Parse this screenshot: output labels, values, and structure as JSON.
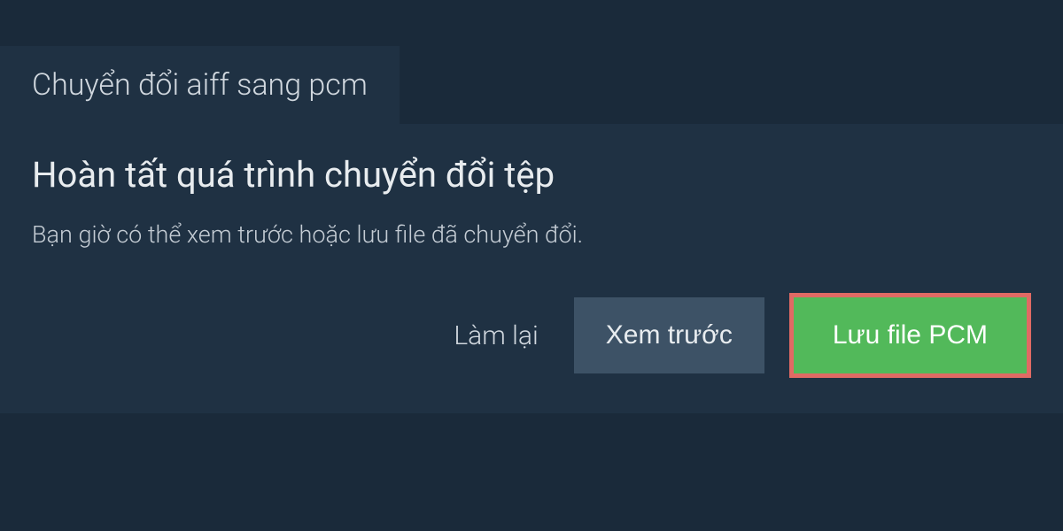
{
  "tab": {
    "label": "Chuyển đổi aiff sang pcm"
  },
  "content": {
    "title": "Hoàn tất quá trình chuyển đổi tệp",
    "description": "Bạn giờ có thể xem trước hoặc lưu file đã chuyển đổi."
  },
  "actions": {
    "retry_label": "Làm lại",
    "preview_label": "Xem trước",
    "save_label": "Lưu file PCM"
  },
  "colors": {
    "background": "#1a2a3a",
    "panel": "#1f3143",
    "secondary_button": "#3d5266",
    "primary_button": "#52b95a",
    "highlight_border": "#e06a64"
  }
}
